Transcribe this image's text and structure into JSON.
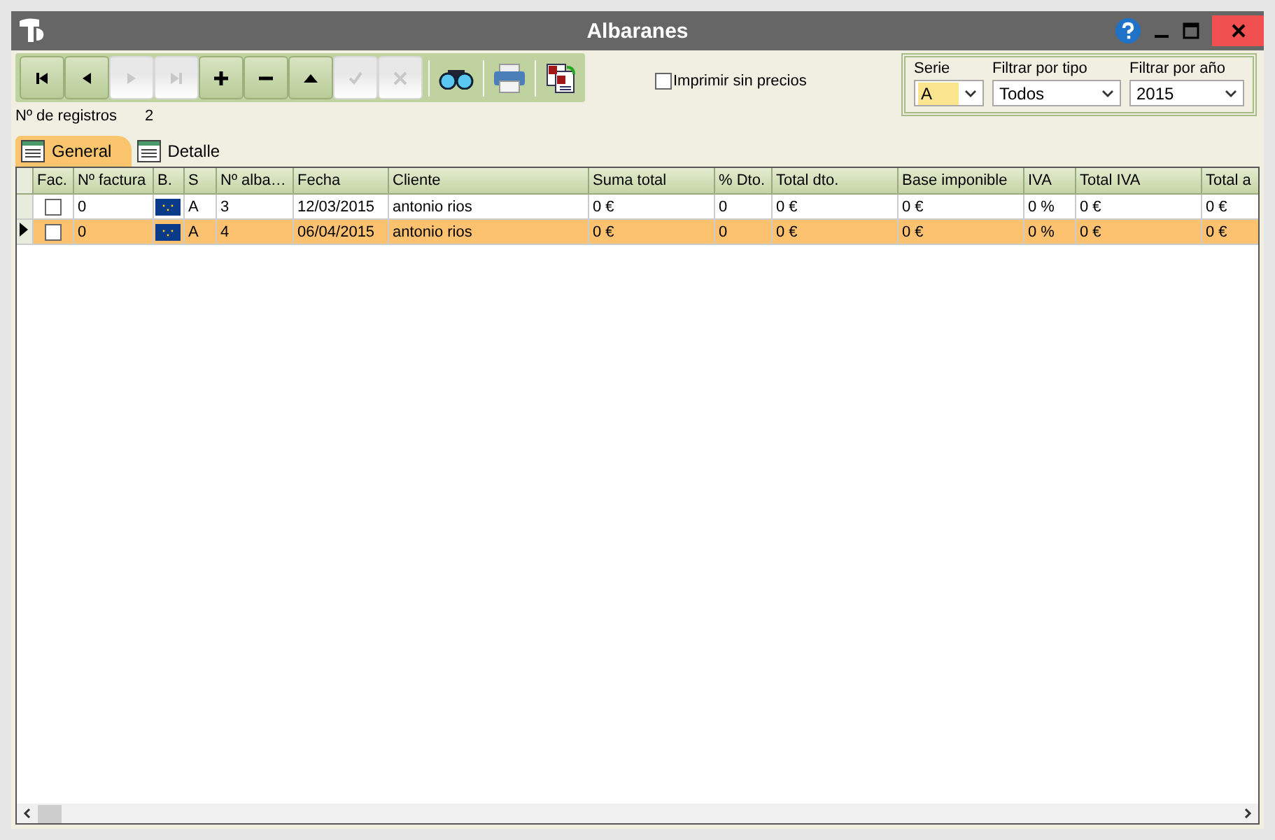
{
  "window": {
    "title": "Albaranes"
  },
  "toolbar": {
    "buttons": [
      {
        "kind": "first",
        "disabled": false
      },
      {
        "kind": "prev",
        "disabled": false
      },
      {
        "kind": "next",
        "disabled": true
      },
      {
        "kind": "last",
        "disabled": true
      },
      {
        "kind": "add",
        "disabled": false
      },
      {
        "kind": "remove",
        "disabled": false
      },
      {
        "kind": "up",
        "disabled": false
      },
      {
        "kind": "accept",
        "disabled": true
      },
      {
        "kind": "cancel",
        "disabled": true
      }
    ],
    "tools": [
      {
        "kind": "search"
      },
      {
        "kind": "print"
      },
      {
        "kind": "report"
      }
    ]
  },
  "print_option": {
    "label": "Imprimir sin precios",
    "checked": false
  },
  "filters": [
    {
      "label": "Serie",
      "value": "A",
      "highlighted": true
    },
    {
      "label": "Filtrar por tipo",
      "value": "Todos",
      "highlighted": false
    },
    {
      "label": "Filtrar por año",
      "value": "2015",
      "highlighted": false
    }
  ],
  "records": {
    "label": "Nº de registros",
    "value": "2"
  },
  "tabs": [
    {
      "label": "General",
      "selected": true
    },
    {
      "label": "Detalle",
      "selected": false
    }
  ],
  "table": {
    "columns": [
      "Fac.",
      "Nº factura",
      "B.",
      "S",
      "Nº alba…",
      "Fecha",
      "Cliente",
      "Suma total",
      "% Dto.",
      "Total dto.",
      "Base imponible",
      "IVA",
      "Total IVA",
      "Total a"
    ],
    "rows": [
      {
        "selected": false,
        "invoiced": false,
        "cells": [
          "",
          "0",
          "",
          "A",
          "3",
          "12/03/2015",
          "antonio rios",
          "0 €",
          "0",
          "0 €",
          "0 €",
          "0 %",
          "0 €",
          "0 €"
        ]
      },
      {
        "selected": true,
        "invoiced": false,
        "cells": [
          "",
          "0",
          "",
          "A",
          "4",
          "06/04/2015",
          "antonio rios",
          "0 €",
          "0",
          "0 €",
          "0 €",
          "0 %",
          "0 €",
          "0 €"
        ]
      }
    ]
  }
}
